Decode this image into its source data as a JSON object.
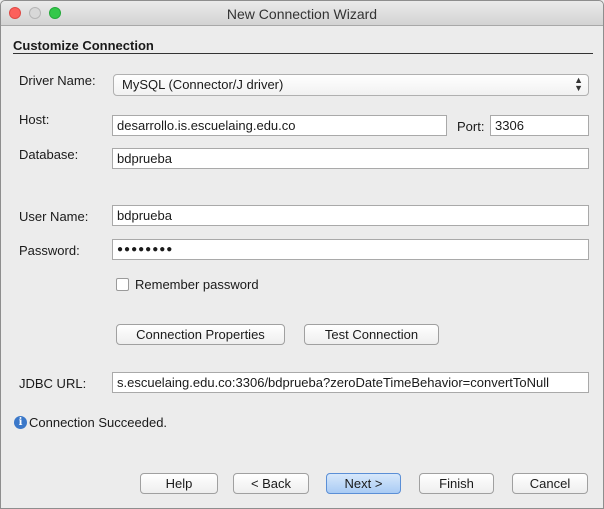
{
  "window": {
    "title": "New Connection Wizard"
  },
  "section": {
    "title": "Customize Connection"
  },
  "form": {
    "driver_label": "Driver Name:",
    "driver_value": "MySQL (Connector/J driver)",
    "host_label": "Host:",
    "host_value": "desarrollo.is.escuelaing.edu.co",
    "port_label": "Port:",
    "port_value": "3306",
    "database_label": "Database:",
    "database_value": "bdprueba",
    "username_label": "User Name:",
    "username_value": "bdprueba",
    "password_label": "Password:",
    "password_value": "●●●●●●●●",
    "remember_label": "Remember password",
    "remember_checked": false,
    "jdbc_label": "JDBC URL:",
    "jdbc_value": "s.escuelaing.edu.co:3306/bdprueba?zeroDateTimeBehavior=convertToNull"
  },
  "actions": {
    "connection_properties": "Connection Properties",
    "test_connection": "Test Connection"
  },
  "status": {
    "text": "Connection Succeeded."
  },
  "footer": {
    "help": "Help",
    "back": "< Back",
    "next": "Next >",
    "finish": "Finish",
    "cancel": "Cancel"
  }
}
